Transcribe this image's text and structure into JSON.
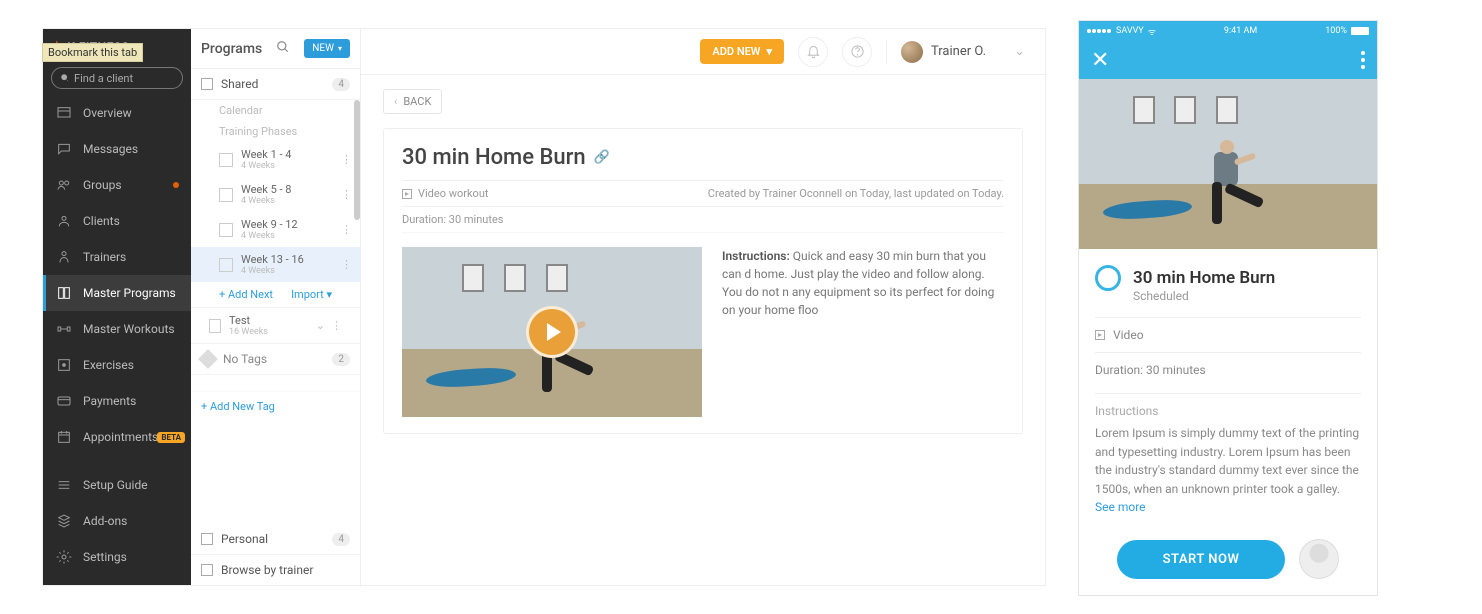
{
  "tooltip": {
    "bookmark": "Bookmark this tab"
  },
  "brand": {
    "text": "K FITNESS"
  },
  "search": {
    "placeholder": "Find a client"
  },
  "nav": {
    "overview": "Overview",
    "messages": "Messages",
    "groups": "Groups",
    "clients": "Clients",
    "trainers": "Trainers",
    "master_programs": "Master Programs",
    "master_workouts": "Master Workouts",
    "exercises": "Exercises",
    "payments": "Payments",
    "appointments": "Appointments",
    "appointments_badge": "BETA",
    "setup_guide": "Setup Guide",
    "addons": "Add-ons",
    "settings": "Settings"
  },
  "programs": {
    "title": "Programs",
    "new_btn": "NEW",
    "shared": "Shared",
    "shared_count": "4",
    "calendar_label": "Calendar",
    "phases_label": "Training Phases",
    "phases": [
      {
        "title": "Week 1 - 4",
        "sub": "4 Weeks"
      },
      {
        "title": "Week 5 - 8",
        "sub": "4 Weeks"
      },
      {
        "title": "Week 9 - 12",
        "sub": "4 Weeks"
      },
      {
        "title": "Week 13 - 16",
        "sub": "4 Weeks"
      }
    ],
    "add_next": "+ Add Next",
    "import": "Import",
    "test": {
      "title": "Test",
      "sub": "16 Weeks"
    },
    "no_tags": "No Tags",
    "no_tags_count": "2",
    "add_tag": "+ Add New Tag",
    "personal": "Personal",
    "personal_count": "4",
    "browse": "Browse by trainer"
  },
  "topbar": {
    "add_new": "ADD NEW",
    "user": "Trainer O."
  },
  "workout": {
    "back": "BACK",
    "title": "30 min Home Burn",
    "type_label": "Video workout",
    "created_by": "Created by Trainer Oconnell on Today, last updated on Today.",
    "duration": "Duration: 30 minutes",
    "instructions_label": "Instructions:",
    "instructions": " Quick and easy 30 min burn that you can d        home. Just play the video and follow along. You do not n        any equipment so its perfect for doing on your home floo"
  },
  "phone": {
    "carrier": "SAVVY",
    "time": "9:41 AM",
    "battery": "100%",
    "title": "30 min Home Burn",
    "status": "Scheduled",
    "video_label": "Video",
    "duration": "Duration: 30 minutes",
    "instructions_h": "Instructions",
    "instructions": "Lorem Ipsum is simply dummy text of the printing and typesetting industry. Lorem Ipsum has been the industry's standard dummy text ever since the 1500s, when an unknown printer took a galley. ",
    "see_more": "See more",
    "start": "START NOW"
  }
}
